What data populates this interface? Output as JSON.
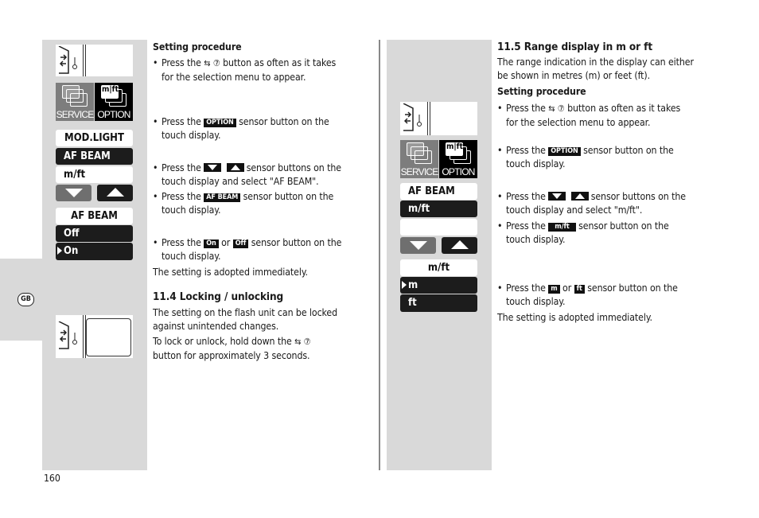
{
  "page_number": "160",
  "language_tab": "GB",
  "display": {
    "service_label": "SERVICE",
    "option_label": "OPTION",
    "mft_icon": "m|ft",
    "left_menu": [
      "MOD.LIGHT",
      "AF BEAM",
      "m/ft"
    ],
    "left_submenu": {
      "title": "AF BEAM",
      "options": [
        "Off",
        "On"
      ],
      "selected": "On"
    },
    "right_menu": [
      "AF BEAM",
      "m/ft",
      ""
    ],
    "right_submenu": {
      "title": "m/ft",
      "options": [
        "m",
        "ft"
      ],
      "selected": "m"
    }
  },
  "left": {
    "setting_procedure": "Setting procedure",
    "s1a": "Press the",
    "s1b": "button as often as it takes",
    "s1c": "for the selection menu to appear.",
    "s2a": "Press the",
    "s2chip": "OPTION",
    "s2b": "sensor button on the",
    "s2c": "touch display.",
    "s3a": "Press the",
    "s3b": "sensor buttons on the",
    "s3c": "touch display and select  \"AF BEAM\".",
    "s4a": "Press the",
    "s4chip": "AF BEAM",
    "s4b": "sensor button on the",
    "s4c": "touch display.",
    "s5a": "Press the",
    "s5chip1": "On",
    "s5or": "or",
    "s5chip2": "Off",
    "s5b": "sensor button on the",
    "s5c": "touch display.",
    "adopted": "The setting is adopted immediately.",
    "h_lock": "11.4 Locking / unlocking",
    "lock1": "The setting on the flash unit can be locked",
    "lock2": "against unintended changes.",
    "lock3a": "To lock or unlock, hold down the",
    "lock4": "button for approximately 3 seconds."
  },
  "right": {
    "heading": "11.5 Range display in m or ft",
    "intro1": "The range indication in the display can either",
    "intro2": "be shown in metres (m) or feet (ft).",
    "setting_procedure": "Setting procedure",
    "s1a": "Press the",
    "s1b": "button as often as it takes",
    "s1c": "for the selection menu to appear.",
    "s2a": "Press the",
    "s2chip": "OPTION",
    "s2b": "sensor button on the",
    "s2c": "touch display.",
    "s3a": "Press the",
    "s3b": "sensor buttons on the",
    "s3c": "touch display and select \"m/ft\".",
    "s4a": "Press the",
    "s4chip": "m/ft",
    "s4b": "sensor button on the",
    "s4c": "touch display.",
    "s5a": "Press the",
    "s5chip1": "m",
    "s5or": "or",
    "s5chip2": "ft",
    "s5b": "sensor button on the",
    "s5c": "touch display.",
    "adopted": "The setting is adopted immediately."
  },
  "symbols": {
    "swap": "⇆",
    "seven": "⑦"
  }
}
